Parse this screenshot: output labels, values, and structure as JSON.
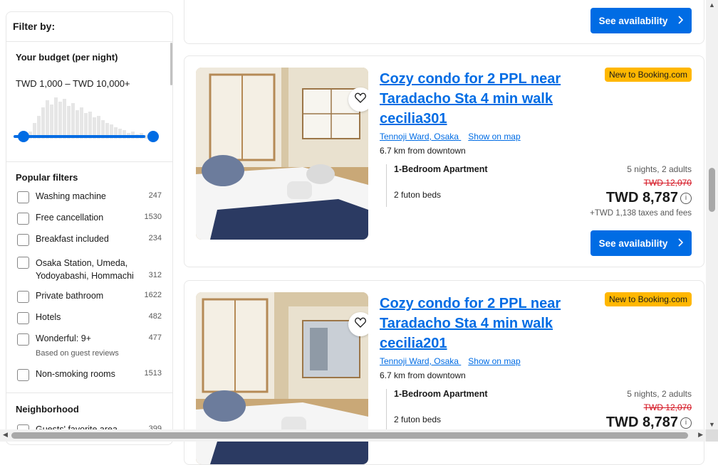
{
  "filters": {
    "heading": "Filter by:",
    "budget": {
      "title": "Your budget (per night)",
      "range": "TWD 1,000 – TWD 10,000+",
      "min_fraction": 0.0,
      "max_fraction": 1.0
    },
    "popular_title": "Popular filters",
    "popular": [
      {
        "label": "Washing machine",
        "count": "247"
      },
      {
        "label": "Free cancellation",
        "count": "1530"
      },
      {
        "label": "Breakfast included",
        "count": "234"
      },
      {
        "label": "Osaka Station, Umeda, Yodoyabashi, Hommachi",
        "count": "312"
      },
      {
        "label": "Private bathroom",
        "count": "1622"
      },
      {
        "label": "Hotels",
        "count": "482"
      },
      {
        "label": "Wonderful: 9+",
        "count": "477",
        "sub": "Based on guest reviews"
      },
      {
        "label": "Non-smoking rooms",
        "count": "1513"
      }
    ],
    "neighborhood_title": "Neighborhood",
    "neighborhood": [
      {
        "label": "Guests' favorite area",
        "count": "399"
      }
    ]
  },
  "top_card": {
    "button": "See availability"
  },
  "listings": [
    {
      "title": "Cozy condo for 2 PPL near Taradacho Sta 4 min walk cecilia301",
      "badge": "New to Booking.com",
      "location": "Tennoji Ward, Osaka",
      "map_link": "Show on map",
      "distance": "6.7 km from downtown",
      "room": "1-Bedroom Apartment",
      "beds": "2 futon beds",
      "stay": "5 nights, 2 adults",
      "old_price": "TWD 12,070",
      "price": "TWD 8,787",
      "taxes": "+TWD 1,138 taxes and fees",
      "button": "See availability"
    },
    {
      "title": "Cozy condo for 2 PPL near Taradacho Sta 4 min walk cecilia201",
      "badge": "New to Booking.com",
      "location": "Tennoji Ward, Osaka",
      "map_link": "Show on map",
      "distance": "6.7 km from downtown",
      "room": "1-Bedroom Apartment",
      "beds": "2 futon beds",
      "stay": "5 nights, 2 adults",
      "old_price": "TWD 12,070",
      "price": "TWD 8,787"
    }
  ],
  "colors": {
    "accent": "#006ce4",
    "badge": "#ffb700",
    "strike": "#d4111e"
  },
  "icons": {
    "heart": "heart-icon",
    "chevron": "chevron-right-icon",
    "info": "info-icon"
  }
}
